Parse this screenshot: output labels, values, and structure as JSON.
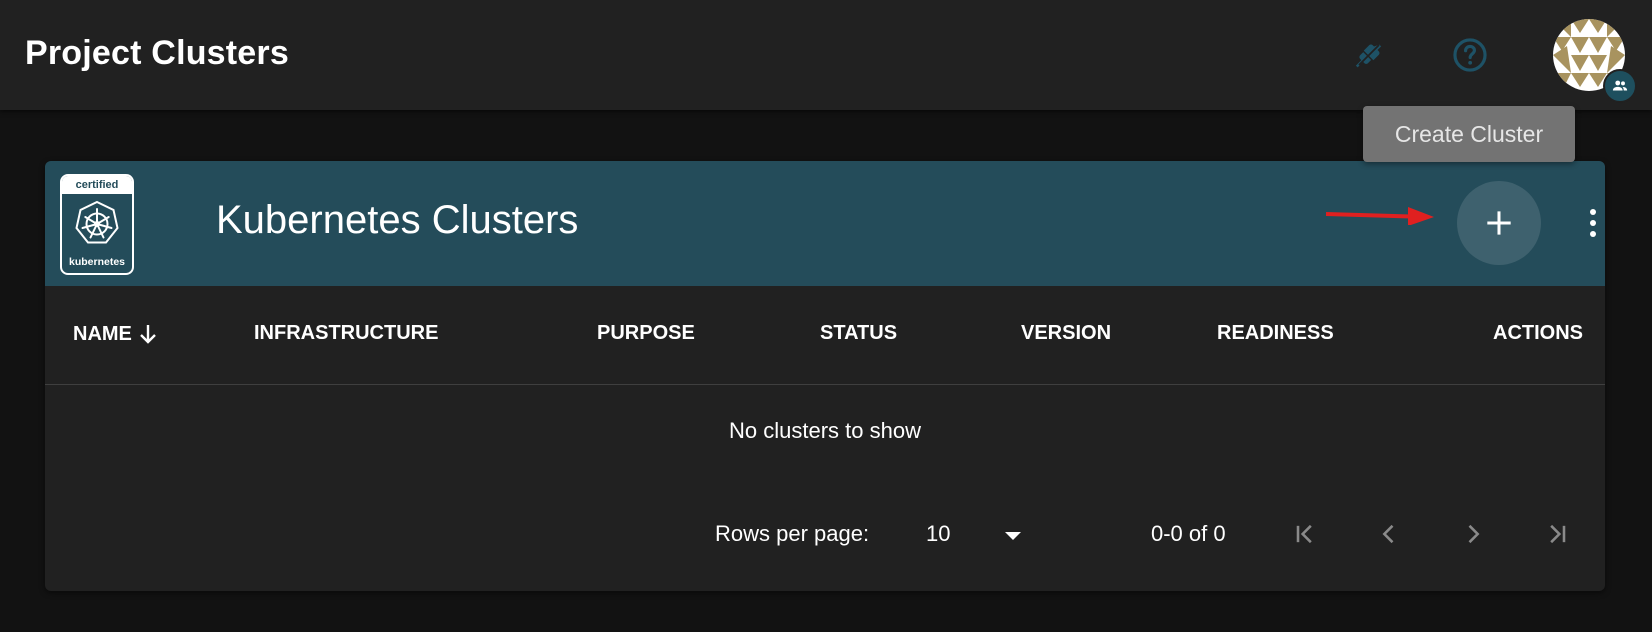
{
  "app_bar": {
    "title": "Project Clusters",
    "plug_icon": "plug-disconnected-icon",
    "help_icon": "help-circle-icon",
    "avatar_icon": "user-avatar-identicon",
    "badge_icon": "account-group-icon"
  },
  "tooltip": {
    "text": "Create Cluster"
  },
  "card": {
    "logo": {
      "top_text": "certified",
      "bottom_text": "kubernetes",
      "icon": "kubernetes-helm-wheel-icon"
    },
    "title": "Kubernetes Clusters",
    "add_icon": "plus-icon",
    "more_icon": "dots-vertical-icon"
  },
  "table": {
    "columns": [
      {
        "label": "NAME",
        "sort_icon": "arrow-down-icon"
      },
      {
        "label": "INFRASTRUCTURE"
      },
      {
        "label": "PURPOSE"
      },
      {
        "label": "STATUS"
      },
      {
        "label": "VERSION"
      },
      {
        "label": "READINESS"
      },
      {
        "label": "ACTIONS"
      }
    ],
    "empty_text": "No clusters to show"
  },
  "pagination": {
    "rows_per_page_label": "Rows per page:",
    "rows_per_page_value": "10",
    "range_text": "0-0 of 0",
    "first_icon": "page-first-icon",
    "prev_icon": "chevron-left-icon",
    "next_icon": "chevron-right-icon",
    "last_icon": "page-last-icon"
  },
  "colors": {
    "background": "#121212",
    "app_bar": "#212121",
    "card_header": "#244c5a",
    "icon_accent": "#1e5266",
    "annotation_arrow": "#e02020"
  }
}
